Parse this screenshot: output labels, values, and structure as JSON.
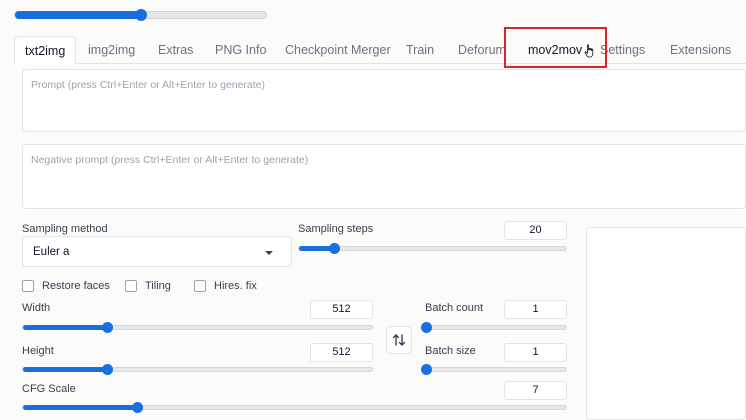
{
  "progress": {
    "value": 0.5
  },
  "tabs": [
    {
      "id": "txt2img",
      "label": "txt2img",
      "active": true
    },
    {
      "id": "img2img",
      "label": "img2img"
    },
    {
      "id": "extras",
      "label": "Extras"
    },
    {
      "id": "png-info",
      "label": "PNG Info"
    },
    {
      "id": "checkpoint-merger",
      "label": "Checkpoint Merger"
    },
    {
      "id": "train",
      "label": "Train"
    },
    {
      "id": "deforum",
      "label": "Deforum"
    },
    {
      "id": "mov2mov",
      "label": "mov2mov"
    },
    {
      "id": "settings",
      "label": "Settings"
    },
    {
      "id": "extensions",
      "label": "Extensions"
    }
  ],
  "prompt": {
    "placeholder": "Prompt (press Ctrl+Enter or Alt+Enter to generate)"
  },
  "negative_prompt": {
    "placeholder": "Negative prompt (press Ctrl+Enter or Alt+Enter to generate)"
  },
  "sampling_method": {
    "label": "Sampling method",
    "value": "Euler a"
  },
  "sampling_steps": {
    "label": "Sampling steps",
    "value": "20",
    "min": 1,
    "max": 150,
    "level": 0.13
  },
  "checkboxes": {
    "restore_faces": "Restore faces",
    "tiling": "Tiling",
    "hires_fix": "Hires. fix"
  },
  "width": {
    "label": "Width",
    "value": "512",
    "level": 0.24
  },
  "height": {
    "label": "Height",
    "value": "512",
    "level": 0.24
  },
  "batch_count": {
    "label": "Batch count",
    "value": "1",
    "level": 0.0
  },
  "batch_size": {
    "label": "Batch size",
    "value": "1",
    "level": 0.0
  },
  "cfg_scale": {
    "label": "CFG Scale",
    "value": "7",
    "level": 0.21
  },
  "colors": {
    "accent": "#1a6fe0",
    "highlight": "#d9232d"
  }
}
